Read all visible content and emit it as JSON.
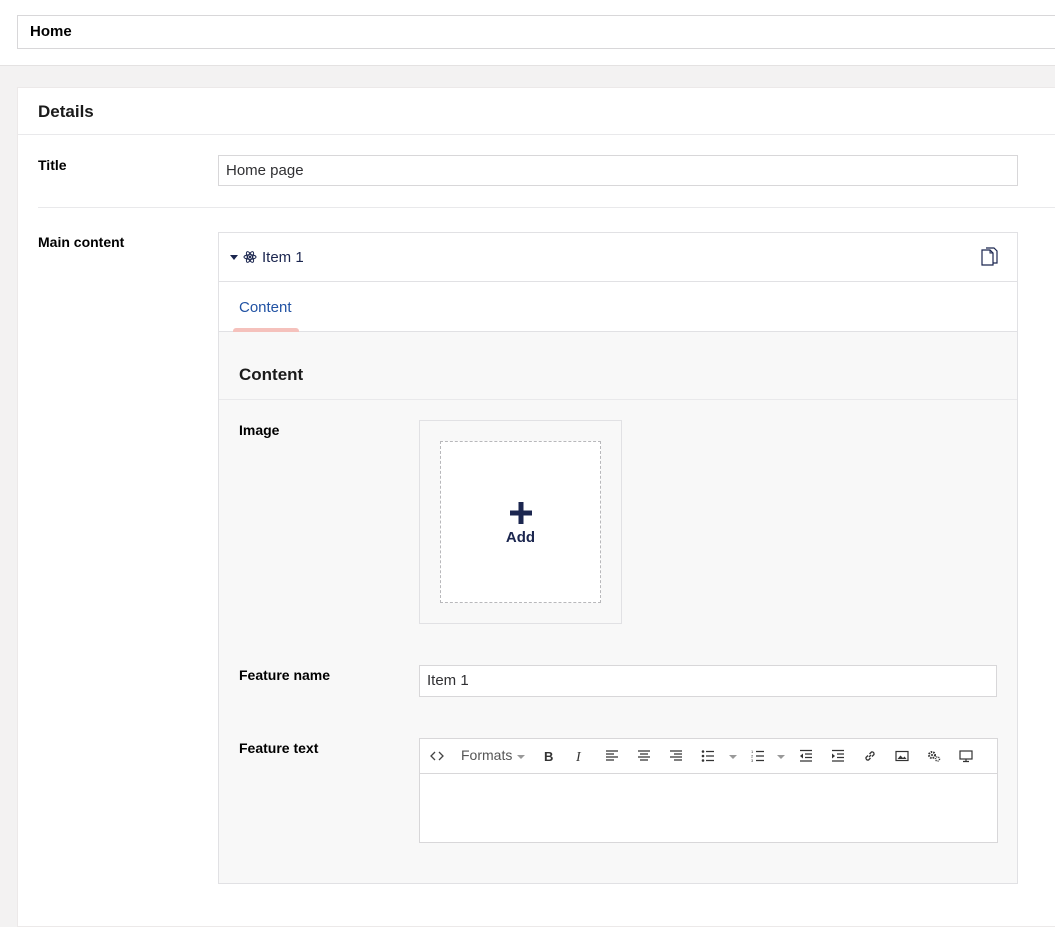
{
  "header": {
    "name_value": "Home"
  },
  "details": {
    "title": "Details",
    "fields": {
      "title_label": "Title",
      "title_value": "Home page",
      "main_content_label": "Main content"
    }
  },
  "block": {
    "name": "Item 1",
    "tabs": [
      {
        "label": "Content",
        "active": true
      }
    ],
    "group_title": "Content",
    "image_label": "Image",
    "add_label": "Add",
    "feature_name_label": "Feature name",
    "feature_name_value": "Item 1",
    "feature_text_label": "Feature text"
  },
  "editor": {
    "formats_label": "Formats",
    "tools": [
      "source-code",
      "formats",
      "bold",
      "italic",
      "align-left",
      "align-center",
      "align-right",
      "bullet-list",
      "numbered-list",
      "outdent",
      "indent",
      "link",
      "image",
      "macro",
      "embed"
    ]
  },
  "colors": {
    "accent": "#1b264f",
    "tab_active_text": "#2152a3",
    "tab_underline": "#f5c1bc",
    "background": "#f3f2f2"
  }
}
